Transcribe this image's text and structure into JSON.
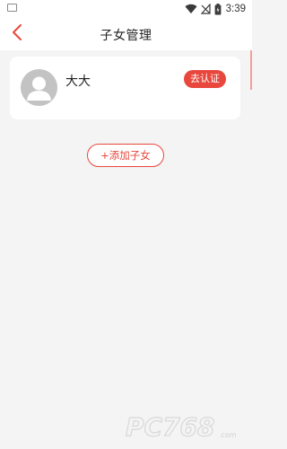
{
  "status_bar": {
    "time": "3:39",
    "icons": [
      "gallery-icon",
      "wifi-icon",
      "no-signal-icon",
      "battery-icon"
    ]
  },
  "nav": {
    "title": "子女管理",
    "back_icon": "chevron-left-icon"
  },
  "children": [
    {
      "name": "大大",
      "avatar_icon": "default-avatar-icon",
      "action_label": "去认证"
    }
  ],
  "add_child_label": "+添加子女",
  "watermark": {
    "brand": "PC768",
    "suffix": ".com"
  },
  "colors": {
    "accent": "#e8473d",
    "background": "#f4f4f4",
    "card": "#ffffff",
    "avatar": "#c3c3c3"
  }
}
